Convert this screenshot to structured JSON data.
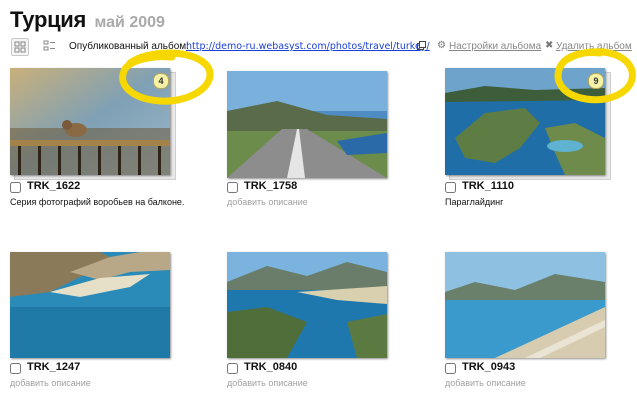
{
  "page": {
    "title": "Турция",
    "subtitle": "май 2009"
  },
  "toolbar": {
    "published_label": "Опубликованный альбом:",
    "published_url": "http://demo-ru.webasyst.com/photos/travel/turkey/",
    "settings_label": "Настройки альбома",
    "delete_label": "Удалить альбом"
  },
  "photos": [
    {
      "name": "TRK_1622",
      "description": "Серия фотографий воробьев на балконе.",
      "described": true,
      "stack_count": "4"
    },
    {
      "name": "TRK_1758",
      "description": "добавить описание",
      "described": false
    },
    {
      "name": "TRK_1110",
      "description": "Параглайдинг",
      "described": true,
      "stack_count": "9"
    },
    {
      "name": "TRK_1247",
      "description": "добавить описание",
      "described": false
    },
    {
      "name": "TRK_0840",
      "description": "добавить описание",
      "described": false
    },
    {
      "name": "TRK_0943",
      "description": "добавить описание",
      "described": false
    }
  ],
  "colors": {
    "link": "#1a3fd6",
    "muted_text": "#a0a0a0",
    "highlight_circle": "#f6d800",
    "badge_fill": "#f5f2a8"
  },
  "icons": {
    "view_grid": "view-grid-icon",
    "view_list": "view-list-icon",
    "external_link": "external-link-icon",
    "settings": "gear-icon",
    "delete": "close-icon"
  }
}
